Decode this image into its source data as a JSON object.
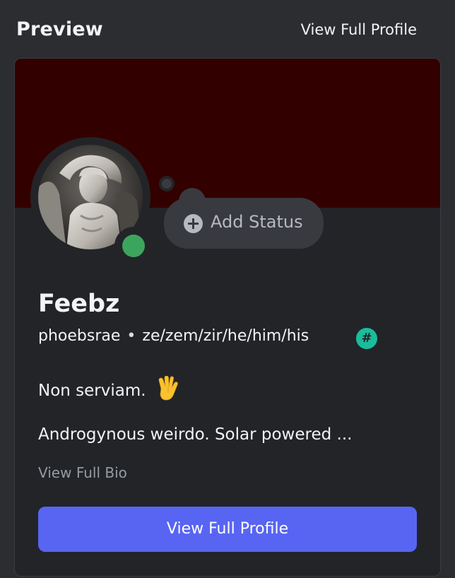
{
  "header": {
    "title": "Preview",
    "view_full_profile_link": "View Full Profile"
  },
  "profile": {
    "banner_color": "#330000",
    "status_color": "#3ba55d",
    "add_status_label": "Add Status",
    "display_name": "Feebz",
    "username": "phoebsrae",
    "pronouns": "ze/zem/zir/he/him/his",
    "badge_symbol": "#",
    "bio_line1": "Non serviam.",
    "bio_line2": "Androgynous weirdo. Solar powered ...",
    "view_bio_label": "View Full Bio",
    "view_full_profile_button": "View Full Profile"
  },
  "colors": {
    "accent": "#5865f2",
    "badge": "#1abc9c"
  }
}
